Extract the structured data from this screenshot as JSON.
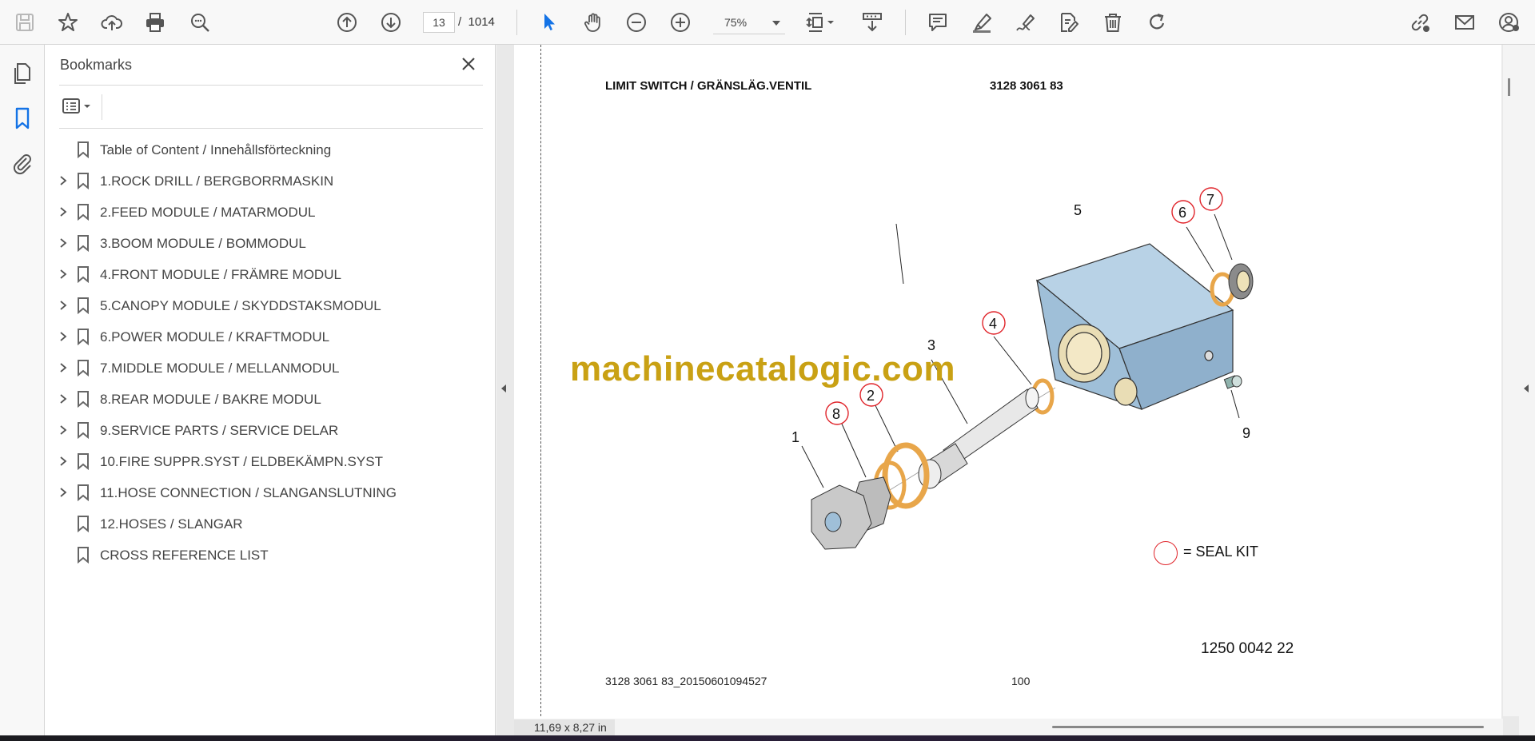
{
  "toolbar": {
    "page_current": "13",
    "page_separator": "/",
    "page_total": "1014",
    "zoom": "75%"
  },
  "bookmarks": {
    "title": "Bookmarks",
    "items": [
      {
        "label": "Table of Content / Innehållsförteckning",
        "expandable": false
      },
      {
        "label": "1.ROCK DRILL / BERGBORRMASKIN",
        "expandable": true
      },
      {
        "label": "2.FEED MODULE / MATARMODUL",
        "expandable": true
      },
      {
        "label": "3.BOOM MODULE / BOMMODUL",
        "expandable": true
      },
      {
        "label": "4.FRONT MODULE / FRÄMRE MODUL",
        "expandable": true
      },
      {
        "label": "5.CANOPY MODULE / SKYDDSTAKSMODUL",
        "expandable": true
      },
      {
        "label": "6.POWER MODULE / KRAFTMODUL",
        "expandable": true
      },
      {
        "label": "7.MIDDLE MODULE / MELLANMODUL",
        "expandable": true
      },
      {
        "label": "8.REAR MODULE / BAKRE MODUL",
        "expandable": true
      },
      {
        "label": "9.SERVICE PARTS / SERVICE DELAR",
        "expandable": true
      },
      {
        "label": "10.FIRE SUPPR.SYST / ELDBEKÄMPN.SYST",
        "expandable": true
      },
      {
        "label": "11.HOSE CONNECTION / SLANGANSLUTNING",
        "expandable": true
      },
      {
        "label": "12.HOSES / SLANGAR",
        "expandable": false
      },
      {
        "label": "CROSS REFERENCE LIST",
        "expandable": false
      }
    ]
  },
  "document": {
    "header_title": "LIMIT SWITCH / GRÄNSLÄG.VENTIL",
    "header_part_no": "3128 3061 83",
    "watermark": "machinecatalogic.com",
    "callouts": [
      "1",
      "2",
      "3",
      "4",
      "5",
      "6",
      "7",
      "8",
      "9"
    ],
    "seal_kit_label": "= SEAL KIT",
    "drawing_number": "1250 0042 22",
    "footer_file": "3128 3061 83_20150601094527",
    "footer_page": "100"
  },
  "status": {
    "page_size": "11,69 x 8,27 in"
  },
  "colors": {
    "accent": "#1473e6",
    "watermark": "#c9a114",
    "seal_ring": "#e0242a",
    "block": "#9fbfd8",
    "washer": "#e8a64a"
  }
}
